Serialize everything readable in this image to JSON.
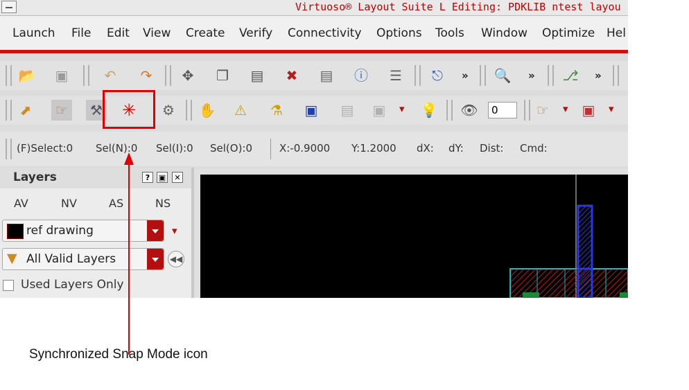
{
  "window": {
    "title": "Virtuoso® Layout Suite L Editing: PDKLIB ntest layou"
  },
  "menu": [
    "Launch",
    "File",
    "Edit",
    "View",
    "Create",
    "Verify",
    "Connectivity",
    "Options",
    "Tools",
    "Window",
    "Optimize",
    "Hel"
  ],
  "toolbar": {
    "more": "»",
    "number_field": "0"
  },
  "status": {
    "select_f": "(F)Select:0",
    "sel_n": "Sel(N):0",
    "sel_i": "Sel(I):0",
    "sel_o": "Sel(O):0",
    "x": "X:-0.9000",
    "y": "Y:1.2000",
    "dx": "dX:",
    "dy": "dY:",
    "dist": "Dist:",
    "cmd": "Cmd:"
  },
  "layers_panel": {
    "title": "Layers",
    "help": "?",
    "float": "▣",
    "close": "✕",
    "columns": [
      "AV",
      "NV",
      "AS",
      "NS"
    ],
    "current_layer": "ref drawing",
    "filter": "All Valid Layers",
    "used_only_label": "Used Layers Only",
    "used_only_checked": false
  },
  "annotation": {
    "label": "Synchronized Snap Mode icon",
    "color": "#e00000"
  },
  "colors": {
    "title": "#c00000",
    "accent_red": "#cc1111",
    "canvas": "#000000"
  }
}
